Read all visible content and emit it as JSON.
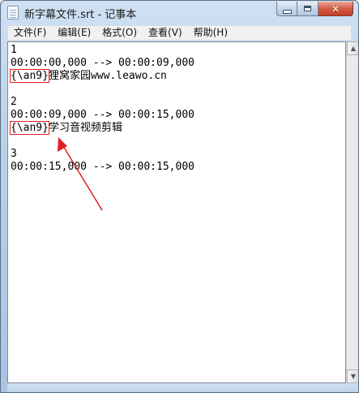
{
  "window": {
    "title": "新字幕文件.srt - 记事本",
    "icon": "notepad-icon",
    "controls": {
      "minimize": "minimize-icon",
      "maximize": "maximize-icon",
      "close": "close-icon"
    }
  },
  "menu": {
    "items": [
      {
        "label": "文件(F)"
      },
      {
        "label": "编辑(E)"
      },
      {
        "label": "格式(O)"
      },
      {
        "label": "查看(V)"
      },
      {
        "label": "帮助(H)"
      }
    ]
  },
  "document": {
    "lines": [
      "1",
      "00:00:00,000 --> 00:00:09,000",
      {
        "tag": "{\\an9}",
        "text": "狸窝家园www.leawo.cn"
      },
      "",
      "2",
      "00:00:09,000 --> 00:00:15,000",
      {
        "tag": "{\\an9}",
        "text": "学习音视频剪辑"
      },
      "",
      "3",
      "00:00:15,000 --> 00:00:15,000"
    ]
  },
  "colors": {
    "annotation": "#e02020"
  }
}
